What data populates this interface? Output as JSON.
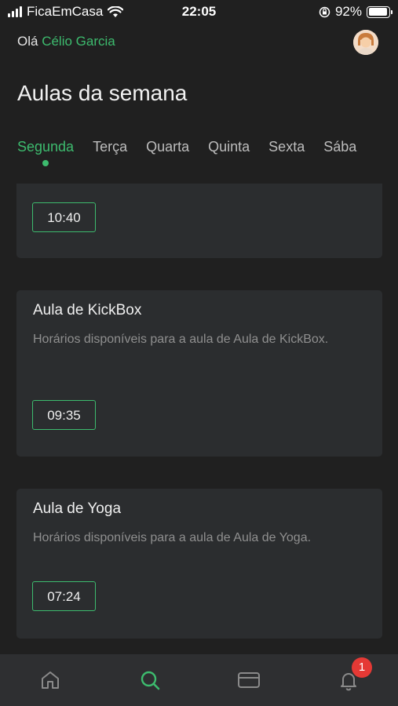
{
  "status_bar": {
    "carrier": "FicaEmCasa",
    "time": "22:05",
    "battery_percent": "92%",
    "battery_level": 0.92
  },
  "header": {
    "greeting_prefix": "Olá",
    "user_name": "Célio Garcia"
  },
  "page_title": "Aulas da semana",
  "days": [
    {
      "label": "Segunda",
      "active": true
    },
    {
      "label": "Terça",
      "active": false
    },
    {
      "label": "Quarta",
      "active": false
    },
    {
      "label": "Quinta",
      "active": false
    },
    {
      "label": "Sexta",
      "active": false
    },
    {
      "label": "Sába",
      "active": false
    }
  ],
  "classes": [
    {
      "title": "",
      "description": "",
      "times": [
        "10:40"
      ]
    },
    {
      "title": "Aula de KickBox",
      "description": "Horários disponíveis para a aula de Aula de KickBox.",
      "times": [
        "09:35"
      ]
    },
    {
      "title": "Aula de Yoga",
      "description": "Horários disponíveis para a aula de Aula de Yoga.",
      "times": [
        "07:24"
      ]
    }
  ],
  "bottom_nav": {
    "items": [
      {
        "icon": "home-icon",
        "active": false
      },
      {
        "icon": "search-icon",
        "active": true
      },
      {
        "icon": "card-icon",
        "active": false
      },
      {
        "icon": "bell-icon",
        "active": false
      }
    ],
    "notification_count": "1"
  },
  "colors": {
    "accent": "#3dbb6e",
    "background": "#202020",
    "card": "#2b2d2f",
    "badge": "#e53935"
  }
}
